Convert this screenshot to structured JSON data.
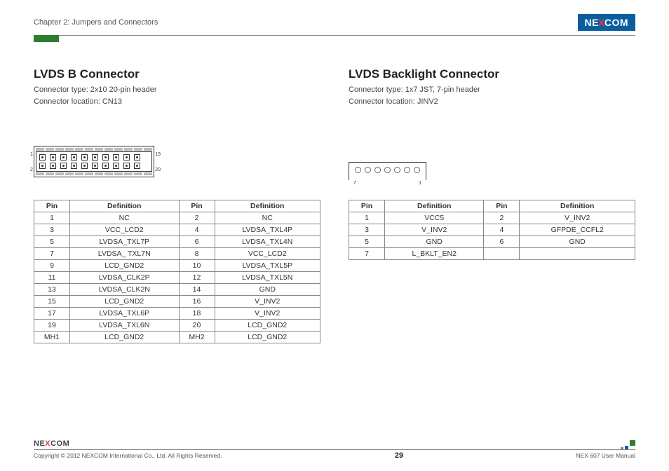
{
  "header": {
    "chapter": "Chapter 2: Jumpers and Connectors",
    "brand": "NEXCOM"
  },
  "left": {
    "title": "LVDS B Connector",
    "type_line": "Connector type: 2x10 20-pin header",
    "loc_line": "Connector location: CN13",
    "diagram_labels": {
      "top_left": "1",
      "bottom_left": "2",
      "top_right": "19",
      "bottom_right": "20"
    },
    "table": {
      "headers": [
        "Pin",
        "Definition",
        "Pin",
        "Definition"
      ],
      "rows": [
        [
          "1",
          "NC",
          "2",
          "NC"
        ],
        [
          "3",
          "VCC_LCD2",
          "4",
          "LVDSA_TXL4P"
        ],
        [
          "5",
          "LVDSA_TXL7P",
          "6",
          "LVDSA_TXL4N"
        ],
        [
          "7",
          "LVDSA_ TXL7N",
          "8",
          "VCC_LCD2"
        ],
        [
          "9",
          "LCD_GND2",
          "10",
          "LVDSA_TXL5P"
        ],
        [
          "11",
          "LVDSA_CLK2P",
          "12",
          "LVDSA_TXL5N"
        ],
        [
          "13",
          "LVDSA_CLK2N",
          "14",
          "GND"
        ],
        [
          "15",
          "LCD_GND2",
          "16",
          "V_INV2"
        ],
        [
          "17",
          "LVDSA_TXL6P",
          "18",
          "V_INV2"
        ],
        [
          "19",
          "LVDSA_TXL6N",
          "20",
          "LCD_GND2"
        ],
        [
          "MH1",
          "LCD_GND2",
          "MH2",
          "LCD_GND2"
        ]
      ]
    }
  },
  "right": {
    "title": "LVDS Backlight Connector",
    "type_line": "Connector type: 1x7 JST, 7-pin header",
    "loc_line": "Connector location: JINV2",
    "diagram_labels": {
      "left": "7",
      "right": "1"
    },
    "table": {
      "headers": [
        "Pin",
        "Definition",
        "Pin",
        "Definition"
      ],
      "rows": [
        [
          "1",
          "VCC5",
          "2",
          "V_INV2"
        ],
        [
          "3",
          "V_INV2",
          "4",
          "GFPDE_CCFL2"
        ],
        [
          "5",
          "GND",
          "6",
          "GND"
        ],
        [
          "7",
          "L_BKLT_EN2",
          "",
          ""
        ]
      ]
    }
  },
  "footer": {
    "copyright": "Copyright © 2012 NEXCOM International Co., Ltd. All Rights Reserved.",
    "page": "29",
    "manual": "NEX 607 User Manual"
  }
}
